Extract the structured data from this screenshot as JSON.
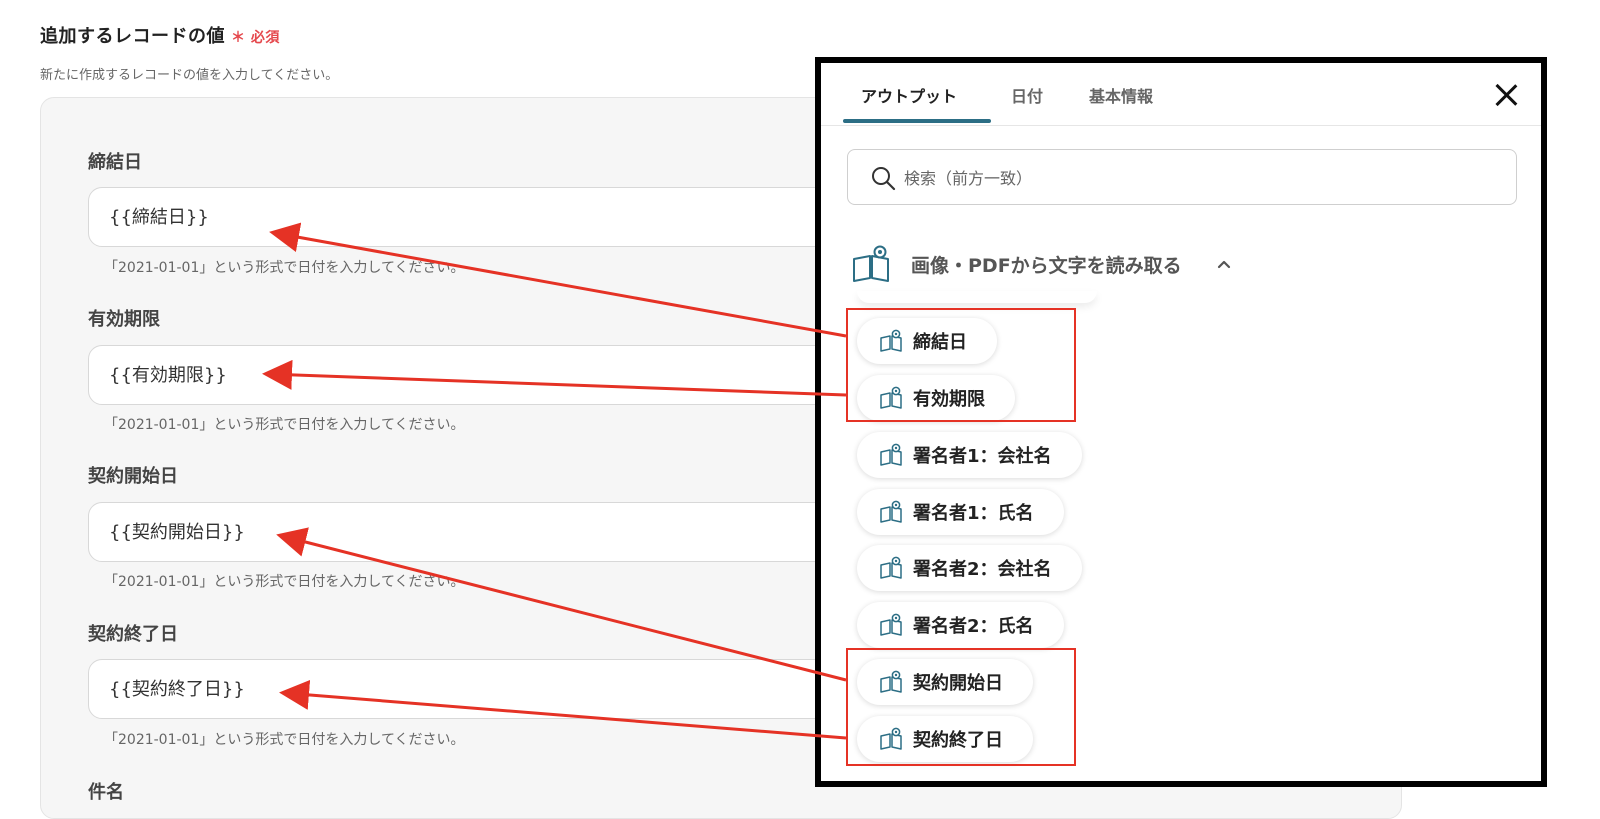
{
  "header": {
    "title": "追加するレコードの値",
    "required_mark": "＊",
    "required": "必須",
    "description": "新たに作成するレコードの値を入力してください。"
  },
  "fields": [
    {
      "label": "締結日",
      "value": "{{締結日}}",
      "hint": "「2021-01-01」という形式で日付を入力してください。"
    },
    {
      "label": "有効期限",
      "value": "{{有効期限}}",
      "hint": "「2021-01-01」という形式で日付を入力してください。"
    },
    {
      "label": "契約開始日",
      "value": "{{契約開始日}}",
      "hint": "「2021-01-01」という形式で日付を入力してください。"
    },
    {
      "label": "契約終了日",
      "value": "{{契約終了日}}",
      "hint": "「2021-01-01」という形式で日付を入力してください。"
    },
    {
      "label": "件名"
    }
  ],
  "panel": {
    "tabs": [
      {
        "label": "アウトプット",
        "active": true
      },
      {
        "label": "日付",
        "active": false
      },
      {
        "label": "基本情報",
        "active": false
      }
    ],
    "search_placeholder": "検索（前方一致）",
    "group": {
      "title": "画像・PDFから文字を読み取る",
      "icon": "book-ocr-icon",
      "expanded": true
    },
    "items": [
      {
        "label": "締結日",
        "highlighted": true
      },
      {
        "label": "有効期限",
        "highlighted": true
      },
      {
        "label": "署名者1：会社名",
        "highlighted": false
      },
      {
        "label": "署名者1：氏名",
        "highlighted": false
      },
      {
        "label": "署名者2：会社名",
        "highlighted": false
      },
      {
        "label": "署名者2：氏名",
        "highlighted": false
      },
      {
        "label": "契約開始日",
        "highlighted": true
      },
      {
        "label": "契約終了日",
        "highlighted": true
      }
    ]
  },
  "colors": {
    "required": "#e5484d",
    "tab_underline": "#2c6e85",
    "annotation": "#e53225",
    "panel_border": "#000000"
  }
}
